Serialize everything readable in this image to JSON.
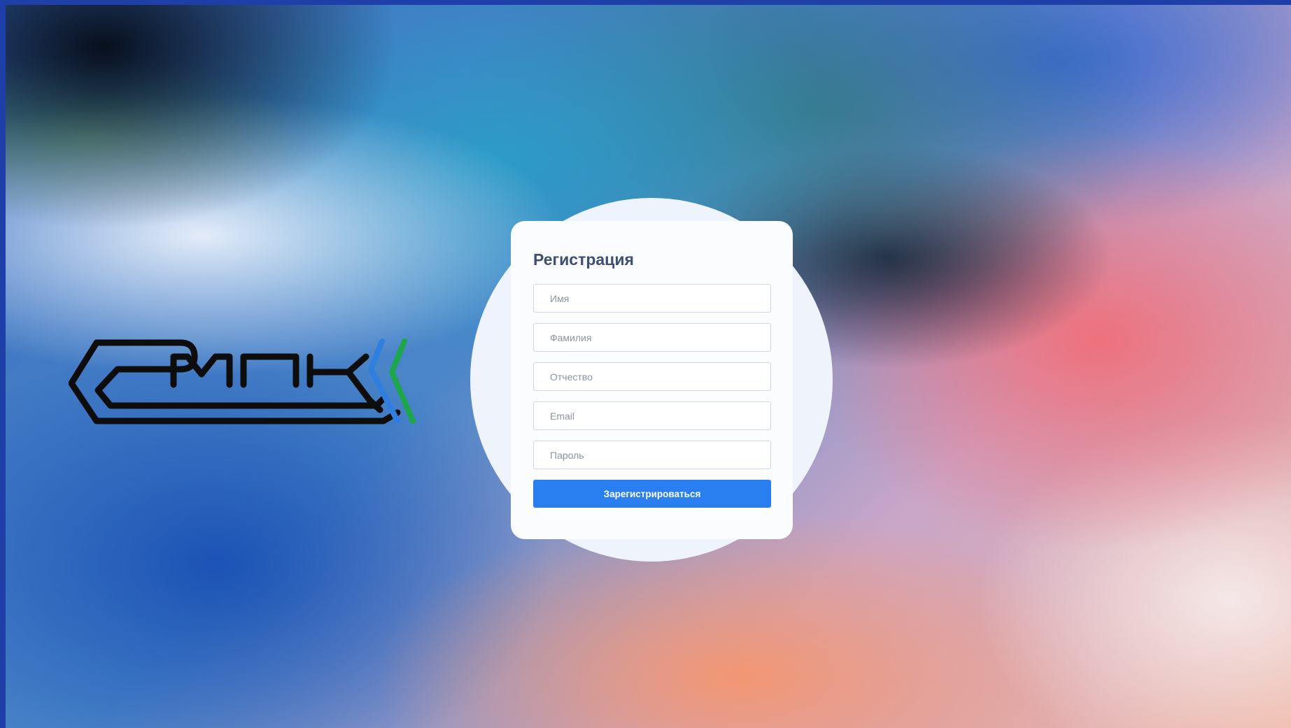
{
  "brand": {
    "logo_icon": "smpk-logo-icon",
    "logo_text": "СМПК",
    "colors": {
      "logo_main": "#0d0d0d",
      "logo_stripe_blue": "#2f7fe0",
      "logo_stripe_green": "#1ea64a"
    }
  },
  "form": {
    "title": "Регистрация",
    "fields": {
      "first_name": {
        "placeholder": "Имя",
        "value": ""
      },
      "last_name": {
        "placeholder": "Фамилия",
        "value": ""
      },
      "middle_name": {
        "placeholder": "Отчество",
        "value": ""
      },
      "email": {
        "placeholder": "Email",
        "value": ""
      },
      "password": {
        "placeholder": "Пароль",
        "value": ""
      }
    },
    "submit_label": "Зарегистрироваться",
    "accent_color": "#2a7ff0"
  }
}
